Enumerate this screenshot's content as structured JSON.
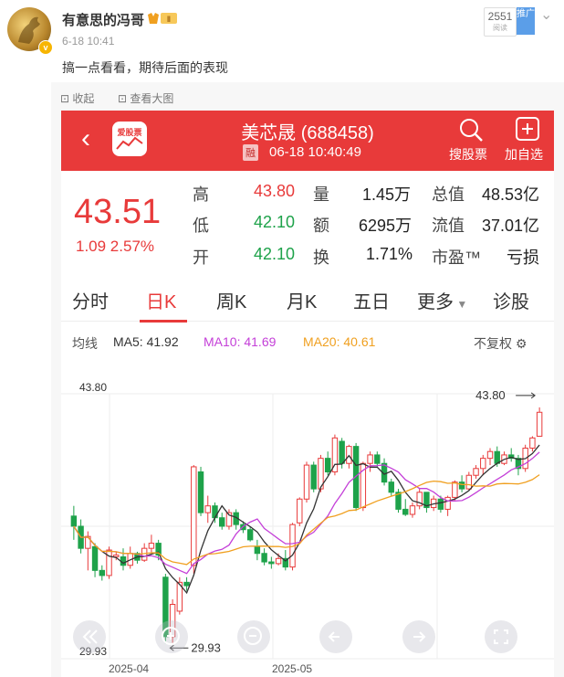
{
  "post": {
    "username": "有意思的冯哥",
    "level": "Ⅱ",
    "time": "6-18 10:41",
    "reads": "2551",
    "reads_label": "阅读",
    "promote": "推广",
    "text": "搞一点看看，期待后面的表现",
    "collapse": "收起",
    "view_large": "查看大图"
  },
  "stock": {
    "app_logo": "爱股票",
    "title": "美芯晟 (688458)",
    "badge": "融",
    "datetime": "06-18 10:40:49",
    "search_label": "搜股票",
    "add_label": "加自选",
    "price": "43.51",
    "change": "1.09  2.57%",
    "quote": {
      "high_label": "高",
      "high": "43.80",
      "low_label": "低",
      "low": "42.10",
      "open_label": "开",
      "open": "42.10",
      "vol_label": "量",
      "vol": "1.45万",
      "amt_label": "额",
      "amt": "6295万",
      "turn_label": "换",
      "turn": "1.71%",
      "mcap_label": "总值",
      "mcap": "48.53亿",
      "float_label": "流值",
      "float": "37.01亿",
      "pe_label": "市盈™",
      "pe": "亏损"
    },
    "tabs": [
      "分时",
      "日K",
      "周K",
      "月K",
      "五日",
      "更多",
      "诊股"
    ],
    "legend": {
      "ma_label": "均线",
      "ma5": "MA5: 41.92",
      "ma10": "MA10: 41.69",
      "ma20": "MA20: 40.61",
      "adjust": "不复权"
    },
    "colors": {
      "up": "#e83a3a",
      "down": "#1ea24a",
      "ma5": "#333333",
      "ma10": "#c440d8",
      "ma20": "#f0a020"
    }
  },
  "chart_data": {
    "type": "candlestick",
    "axis_top_label": "43.80",
    "axis_bottom_label": "29.93",
    "max_marker": "43.80",
    "min_marker": "29.93",
    "x_ticks": [
      "2025-04",
      "2025-05"
    ],
    "ylim": [
      29.0,
      44.6
    ],
    "candles": [
      [
        37.4,
        38.0,
        36.0,
        36.8
      ],
      [
        36.8,
        37.2,
        35.2,
        35.5
      ],
      [
        35.5,
        36.5,
        34.2,
        36.2
      ],
      [
        35.6,
        35.8,
        33.8,
        34.2
      ],
      [
        34.2,
        34.5,
        33.6,
        33.9
      ],
      [
        33.9,
        35.6,
        33.7,
        35.4
      ],
      [
        35.0,
        35.3,
        34.8,
        35.1
      ],
      [
        35.0,
        35.5,
        34.2,
        34.5
      ],
      [
        34.5,
        35.6,
        34.3,
        35.2
      ],
      [
        35.2,
        35.3,
        34.6,
        34.8
      ],
      [
        34.8,
        35.8,
        34.7,
        35.5
      ],
      [
        35.5,
        36.3,
        35.2,
        35.8
      ],
      [
        35.8,
        36.0,
        34.8,
        35.1
      ],
      [
        33.8,
        34.0,
        29.9,
        30.3
      ],
      [
        30.3,
        32.5,
        29.93,
        32.2
      ],
      [
        31.8,
        33.8,
        31.6,
        33.5
      ],
      [
        33.5,
        33.8,
        33.0,
        33.3
      ],
      [
        34.5,
        40.4,
        34.0,
        40.3
      ],
      [
        40.0,
        40.3,
        37.4,
        37.6
      ],
      [
        37.6,
        38.6,
        37.0,
        38.0
      ],
      [
        38.0,
        38.2,
        37.0,
        37.3
      ],
      [
        37.3,
        37.6,
        36.6,
        36.8
      ],
      [
        36.8,
        37.8,
        36.6,
        37.6
      ],
      [
        37.6,
        37.8,
        36.6,
        36.9
      ],
      [
        36.9,
        37.1,
        36.4,
        36.6
      ],
      [
        36.6,
        36.8,
        35.9,
        36.0
      ],
      [
        35.6,
        36.0,
        34.8,
        35.2
      ],
      [
        35.2,
        35.5,
        34.5,
        34.7
      ],
      [
        34.7,
        35.0,
        34.3,
        34.6
      ],
      [
        34.6,
        35.2,
        34.5,
        34.9
      ],
      [
        34.9,
        35.4,
        34.2,
        34.4
      ],
      [
        34.4,
        37.0,
        34.2,
        36.9
      ],
      [
        37.0,
        38.5,
        36.8,
        38.4
      ],
      [
        38.4,
        40.6,
        38.2,
        40.4
      ],
      [
        40.4,
        40.6,
        38.8,
        39.0
      ],
      [
        39.0,
        41.0,
        38.8,
        40.8
      ],
      [
        40.8,
        41.2,
        39.8,
        40.0
      ],
      [
        40.0,
        42.2,
        39.8,
        42.0
      ],
      [
        41.8,
        42.0,
        40.2,
        40.5
      ],
      [
        40.5,
        41.6,
        40.2,
        41.5
      ],
      [
        41.5,
        41.7,
        37.7,
        37.9
      ],
      [
        37.9,
        40.6,
        37.7,
        40.5
      ],
      [
        40.5,
        41.2,
        40.0,
        41.0
      ],
      [
        41.0,
        41.2,
        40.3,
        40.5
      ],
      [
        40.5,
        40.8,
        39.2,
        39.4
      ],
      [
        39.4,
        39.6,
        38.6,
        38.8
      ],
      [
        38.8,
        39.0,
        37.6,
        37.8
      ],
      [
        37.8,
        38.4,
        37.4,
        37.5
      ],
      [
        37.5,
        38.2,
        37.3,
        38.0
      ],
      [
        38.0,
        39.0,
        37.8,
        38.8
      ],
      [
        38.8,
        38.8,
        37.6,
        37.9
      ],
      [
        37.9,
        38.6,
        37.7,
        38.4
      ],
      [
        38.4,
        38.6,
        37.6,
        37.8
      ],
      [
        37.8,
        38.6,
        37.4,
        38.5
      ],
      [
        38.5,
        39.5,
        38.3,
        39.4
      ],
      [
        39.4,
        39.8,
        38.8,
        39.0
      ],
      [
        39.0,
        40.0,
        38.9,
        39.8
      ],
      [
        39.8,
        40.4,
        39.6,
        40.2
      ],
      [
        40.2,
        41.0,
        39.8,
        40.8
      ],
      [
        40.8,
        41.4,
        40.4,
        41.2
      ],
      [
        41.2,
        41.5,
        40.3,
        40.5
      ],
      [
        40.5,
        41.2,
        40.4,
        41.0
      ],
      [
        41.0,
        41.4,
        40.6,
        40.8
      ],
      [
        40.8,
        41.0,
        39.8,
        40.2
      ],
      [
        40.2,
        41.6,
        40.0,
        41.4
      ],
      [
        41.4,
        42.1,
        41.2,
        42.0
      ],
      [
        42.1,
        43.8,
        42.1,
        43.51
      ]
    ]
  }
}
